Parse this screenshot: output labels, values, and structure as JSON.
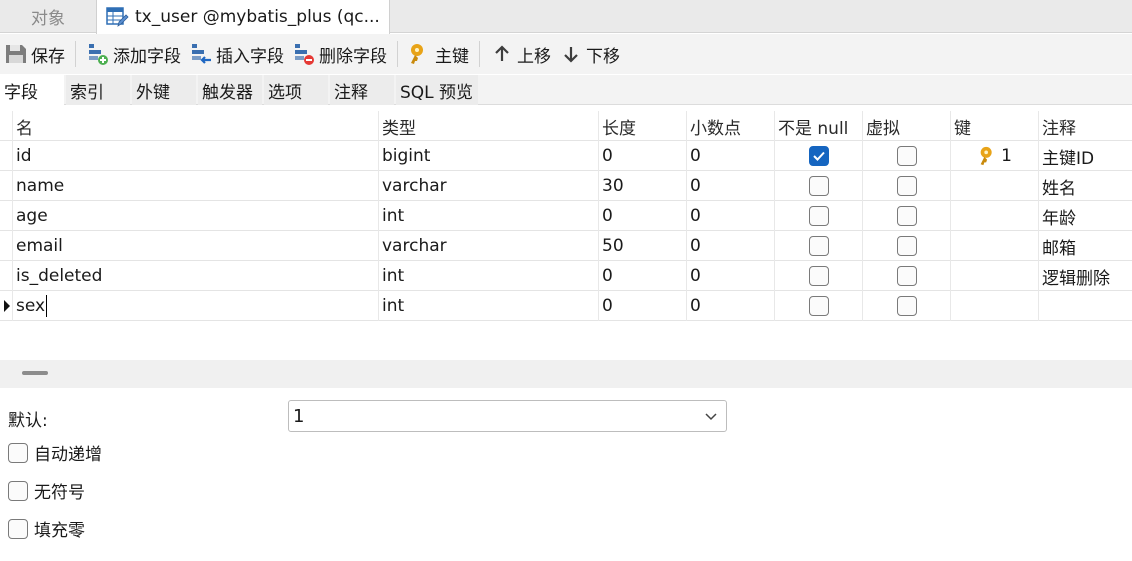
{
  "tabs": {
    "objects_label": "对象",
    "active_title": "tx_user @mybatis_plus (qc..."
  },
  "toolbar": {
    "save": "保存",
    "add_field": "添加字段",
    "insert_field": "插入字段",
    "delete_field": "删除字段",
    "primary_key": "主键",
    "move_up": "上移",
    "move_down": "下移"
  },
  "subtabs": [
    "字段",
    "索引",
    "外键",
    "触发器",
    "选项",
    "注释",
    "SQL 预览"
  ],
  "grid": {
    "headers": [
      "名",
      "类型",
      "长度",
      "小数点",
      "不是 null",
      "虚拟",
      "键",
      "注释"
    ],
    "rows": [
      {
        "name": "id",
        "type": "bigint",
        "length": "0",
        "decimals": "0",
        "not_null": true,
        "virtual": false,
        "key": "1",
        "comment": "主键ID"
      },
      {
        "name": "name",
        "type": "varchar",
        "length": "30",
        "decimals": "0",
        "not_null": false,
        "virtual": false,
        "key": "",
        "comment": "姓名"
      },
      {
        "name": "age",
        "type": "int",
        "length": "0",
        "decimals": "0",
        "not_null": false,
        "virtual": false,
        "key": "",
        "comment": "年龄"
      },
      {
        "name": "email",
        "type": "varchar",
        "length": "50",
        "decimals": "0",
        "not_null": false,
        "virtual": false,
        "key": "",
        "comment": "邮箱"
      },
      {
        "name": "is_deleted",
        "type": "int",
        "length": "0",
        "decimals": "0",
        "not_null": false,
        "virtual": false,
        "key": "",
        "comment": "逻辑删除"
      },
      {
        "name": "sex",
        "type": "int",
        "length": "0",
        "decimals": "0",
        "not_null": false,
        "virtual": false,
        "key": "",
        "comment": ""
      }
    ]
  },
  "properties": {
    "default_label": "默认:",
    "default_value": "1",
    "auto_increment": "自动递增",
    "unsigned": "无符号",
    "zerofill": "填充零"
  },
  "colors": {
    "accent": "#1565c0",
    "key_gold": "#e8a317"
  }
}
